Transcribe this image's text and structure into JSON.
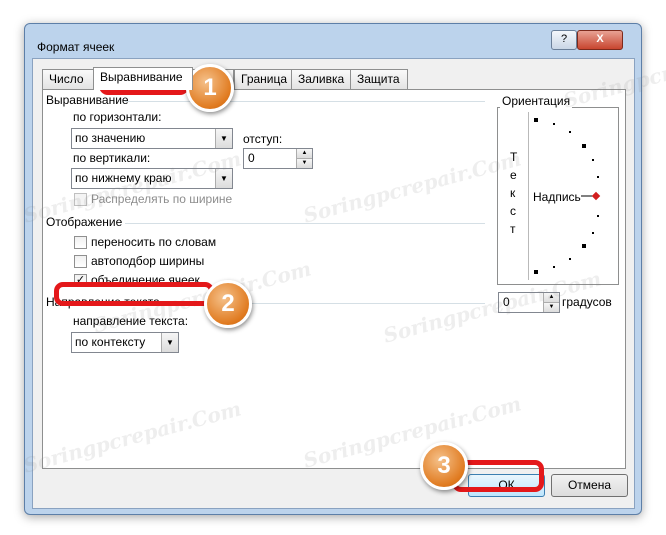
{
  "window": {
    "title": "Формат ячеек",
    "help_label": "?",
    "close_label": "X"
  },
  "tabs": [
    {
      "label": "Число"
    },
    {
      "label": "Выравнивание",
      "active": true
    },
    {
      "label": "т"
    },
    {
      "label": "Граница"
    },
    {
      "label": "Заливка"
    },
    {
      "label": "Защита"
    }
  ],
  "alignment": {
    "group_title": "Выравнивание",
    "horizontal_label": "по горизонтали:",
    "horizontal_value": "по значению",
    "indent_label": "отступ:",
    "indent_value": "0",
    "vertical_label": "по вертикали:",
    "vertical_value": "по нижнему краю",
    "distribute_label": "Распределять по ширине",
    "distribute_checked": false
  },
  "display": {
    "group_title": "Отображение",
    "wrap_label": "переносить по словам",
    "wrap_checked": false,
    "shrink_label": "автоподбор ширины",
    "shrink_checked": false,
    "merge_label": "объединение ячеек",
    "merge_checked": true,
    "check_mark": "✓"
  },
  "direction": {
    "group_title": "Направление текста",
    "direction_label": "направление текста:",
    "direction_value": "по контексту"
  },
  "orientation": {
    "group_title": "Ориентация",
    "vertical_text": [
      "Т",
      "е",
      "к",
      "с",
      "т"
    ],
    "dial_label": "Надпись",
    "degrees_value": "0",
    "degrees_label": "градусов"
  },
  "buttons": {
    "ok": "ОК",
    "cancel": "Отмена"
  },
  "annotations": {
    "badge_1": "1",
    "badge_2": "2",
    "badge_3": "3"
  },
  "watermark": "Soringpcrepair.Com",
  "colors": {
    "callout": "#e4181a",
    "badge": "#e07a1f",
    "dial_marker": "#d21e1e"
  }
}
